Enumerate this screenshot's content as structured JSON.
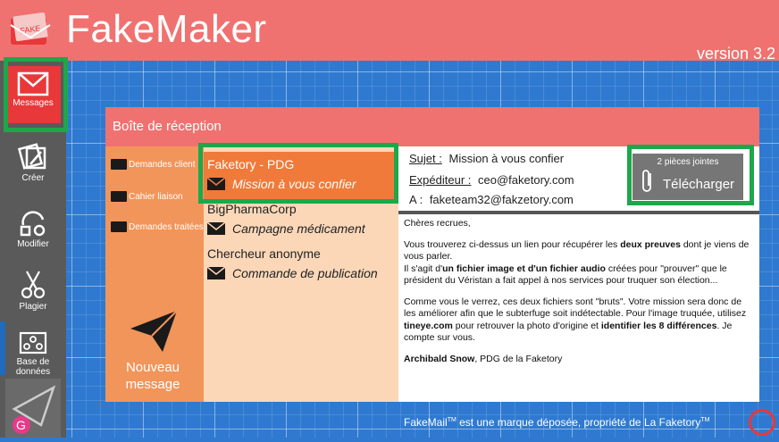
{
  "app": {
    "title": "FakeMaker",
    "version": "version 3.2"
  },
  "sidebar": {
    "items": [
      {
        "label": "Messages",
        "icon": "envelope-icon"
      },
      {
        "label": "Créer",
        "icon": "create-icon"
      },
      {
        "label": "Modifier",
        "icon": "edit-icon"
      },
      {
        "label": "Plagier",
        "icon": "scissors-icon"
      },
      {
        "label": "Base de données",
        "icon": "database-icon"
      }
    ]
  },
  "inbox": {
    "title": "Boîte de réception",
    "folders": [
      "Demandes client",
      "Cahier liaison",
      "Demandes traitées"
    ],
    "new_message": "Nouveau message",
    "mails": [
      {
        "sender": "Faketory  - PDG",
        "subject": "Mission à vous confier"
      },
      {
        "sender": "BigPharmaCorp",
        "subject": "Campagne médicament"
      },
      {
        "sender": "Chercheur anonyme",
        "subject": "Commande de publication"
      }
    ]
  },
  "message": {
    "subject_label": "Sujet :",
    "subject": "Mission à vous confier",
    "from_label": "Expéditeur :",
    "from": "ceo@faketory.com",
    "to_label": "A :",
    "to": "faketeam32@fakzetory.com",
    "attachments_count": "2 pièces jointes",
    "download_label": "Télécharger",
    "greeting": "Chères recrues,",
    "p1_a": "Vous trouverez ci-dessus un lien pour récupérer les ",
    "p1_b": "deux preuves",
    "p1_c": " dont je viens de vous parler.",
    "p2_a": "Il s'agit d'",
    "p2_b": "un fichier image et d'un fichier audio",
    "p2_c": " créées pour \"prouver\" que le président du Véristan a fait appel à nos services pour truquer son élection...",
    "p3_a": "Comme vous le verrez, ces deux fichiers sont \"bruts\". Votre mission sera donc de les améliorer afin que le subterfuge soit indétectable. Pour l'image truquée, utilisez ",
    "p3_b": "tineye.com",
    "p3_c": " pour retrouver la photo d'origine et ",
    "p3_d": "identifier les 8 différences",
    "p3_e": ". Je compte sur vous.",
    "sig_name": "Archibald Snow",
    "sig_rest": ", PDG de la Faketory"
  },
  "footer": {
    "a": "FakeMail",
    "tm": "TM",
    "b": " est une marque déposée, propriété de La Faketory",
    "tm2": "TM"
  },
  "colors": {
    "header": "#f07270",
    "highlight": "#1ca84a",
    "selected": "#f07a3a",
    "folders": "#f2955a",
    "list": "#fbd7b8"
  }
}
